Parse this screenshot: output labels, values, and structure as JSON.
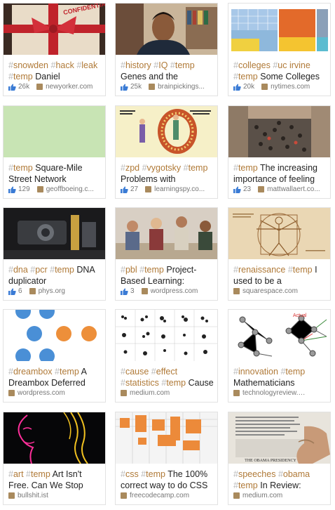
{
  "cards": [
    {
      "tags": [
        "snowden",
        "hack",
        "leak",
        "temp"
      ],
      "title": "Daniel",
      "likes": "26k",
      "site": "newyorker.com",
      "image": "gift-wrapped-document"
    },
    {
      "tags": [
        "history",
        "IQ",
        "temp"
      ],
      "title": "Genes and the",
      "likes": "25k",
      "site": "brainpickings...",
      "image": "man-portrait-bookshelf"
    },
    {
      "tags": [
        "colleges",
        "uc irvine",
        "temp"
      ],
      "title": "Some Colleges",
      "likes": "20k",
      "site": "nytimes.com",
      "image": "treemap"
    },
    {
      "tags": [
        "temp"
      ],
      "title": "Square-Mile Street Network",
      "likes": "129",
      "site": "geoffboeing.c...",
      "image": "green-map"
    },
    {
      "tags": [
        "zpd",
        "vygotsky",
        "temp"
      ],
      "title": "Problems with",
      "likes": "27",
      "site": "learningspy.co...",
      "image": "zpd-cartoon"
    },
    {
      "tags": [
        "temp"
      ],
      "title": "The increasing importance of feeling",
      "likes": "23",
      "site": "mattwallaert.co...",
      "image": "crowd-aerial"
    },
    {
      "tags": [
        "dna",
        "pcr",
        "temp"
      ],
      "title": "DNA duplicator",
      "likes": "6",
      "site": "phys.org",
      "image": "lab-device"
    },
    {
      "tags": [
        "pbl",
        "temp"
      ],
      "title": "Project-Based Learning:",
      "likes": "3",
      "site": "wordpress.com",
      "image": "students-group"
    },
    {
      "tags": [
        "renaissance",
        "temp"
      ],
      "title": "I used to be a",
      "likes": "",
      "site": "squarespace.com",
      "image": "vitruvian-man"
    },
    {
      "tags": [
        "dreambox",
        "temp"
      ],
      "title": "A Dreambox Deferred",
      "likes": "",
      "site": "wordpress.com",
      "image": "blue-orange-circles"
    },
    {
      "tags": [
        "cause",
        "effect",
        "statistics",
        "temp"
      ],
      "title": "Cause",
      "likes": "",
      "site": "medium.com",
      "image": "scatter-grid"
    },
    {
      "tags": [
        "innovation",
        "temp"
      ],
      "title": "Mathematicians",
      "likes": "",
      "site": "technologyreview.com",
      "image": "network-graph"
    },
    {
      "tags": [
        "art",
        "temp"
      ],
      "title": "Art Isn't Free. Can We Stop",
      "likes": "",
      "site": "bullshit.ist",
      "image": "neon-face"
    },
    {
      "tags": [
        "css",
        "temp"
      ],
      "title": "The 100% correct way to do CSS",
      "likes": "",
      "site": "freecodecamp.com",
      "image": "orange-blocks"
    },
    {
      "tags": [
        "speeches",
        "obama",
        "temp"
      ],
      "title": "In Review:",
      "likes": "",
      "site": "medium.com",
      "image": "newspaper-hand"
    }
  ],
  "thumbnail_texts": {
    "card0_stamp": "CONFIDENTIAL",
    "card8_sketch": "",
    "card11_label": "Actual",
    "card14_headline": "THE OBAMA PRESIDENCY"
  }
}
